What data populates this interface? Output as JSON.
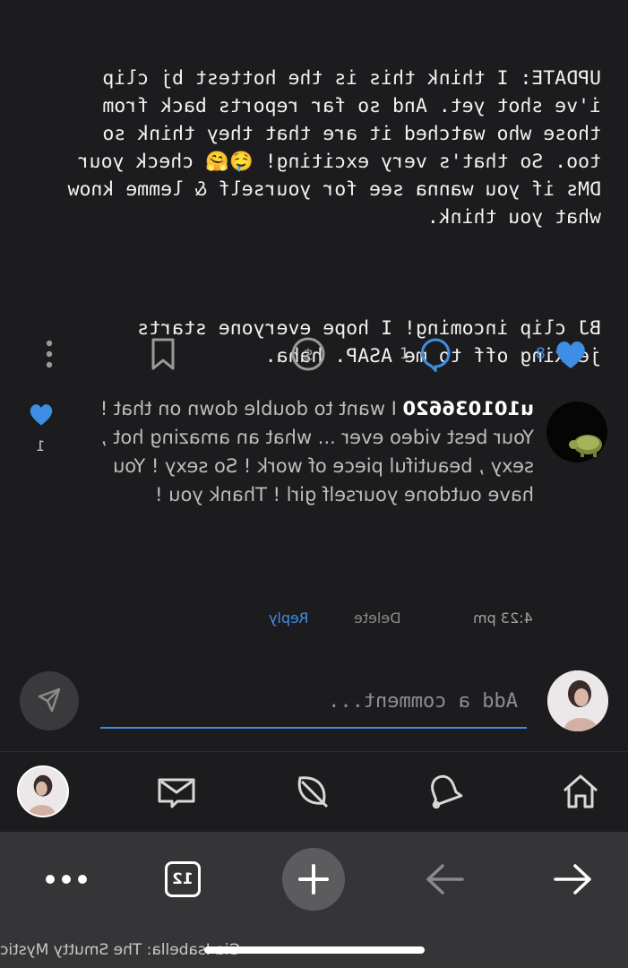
{
  "post": {
    "update_text": "UPDATE: I think this is the hottest bj clip i've shot yet. And so far reports back from those who watched it are that they think so too. So that's very exciting! 🤤🤗 check your DMs if you wanna see for yourself & lemme know what you think.",
    "second_text": "BJ clip incoming! I hope everyone starts jerking off to me ASAP. haha."
  },
  "actions": {
    "like_count": "8",
    "comment_count": "1",
    "like_icon": "heart-icon",
    "comment_icon": "speech-bubble-icon",
    "tip_icon": "dollar-coin-icon",
    "bookmark_icon": "bookmark-icon",
    "more_icon": "vertical-dots-icon"
  },
  "comment": {
    "username": "u101036620",
    "text": "I want to double down on that ! Your best video ever ... what an amazing hot , sexy , beautiful piece of work ! So sexy ! You have outdone yourself girl ! Thank you !",
    "time": "4:23 pm",
    "delete_label": "Delete",
    "reply_label": "Reply",
    "like_count": "1"
  },
  "compose": {
    "placeholder": "Add a comment..."
  },
  "appnav": {
    "items": [
      "home-icon",
      "bell-icon",
      "leaf-icon",
      "envelope-icon",
      "avatar"
    ]
  },
  "browser": {
    "tab_count": "12",
    "site_title": "Gia Isabella: The Smutty Mystic"
  },
  "colors": {
    "background": "#1c1c1e",
    "accent": "#3f8ee5",
    "toolbar": "#353537"
  }
}
